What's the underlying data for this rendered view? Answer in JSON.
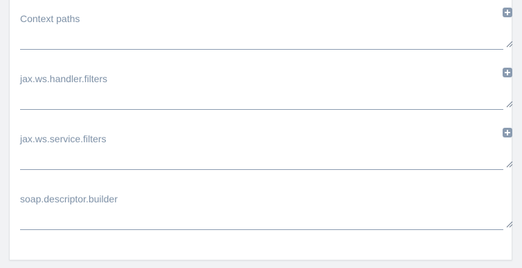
{
  "fields": [
    {
      "label": "Context paths",
      "value": "",
      "has_add": true
    },
    {
      "label": "jax.ws.handler.filters",
      "value": "",
      "has_add": true
    },
    {
      "label": "jax.ws.service.filters",
      "value": "",
      "has_add": true
    },
    {
      "label": "soap.descriptor.builder",
      "value": "",
      "has_add": false
    }
  ],
  "icons": {
    "add": "plus-square-icon",
    "resize": "resize-grip-icon"
  },
  "colors": {
    "label": "#7e91a7",
    "icon": "#8a9bb0",
    "underline": "#8a9bb0",
    "panel": "#ffffff",
    "page_background": "#f1f2f4"
  }
}
